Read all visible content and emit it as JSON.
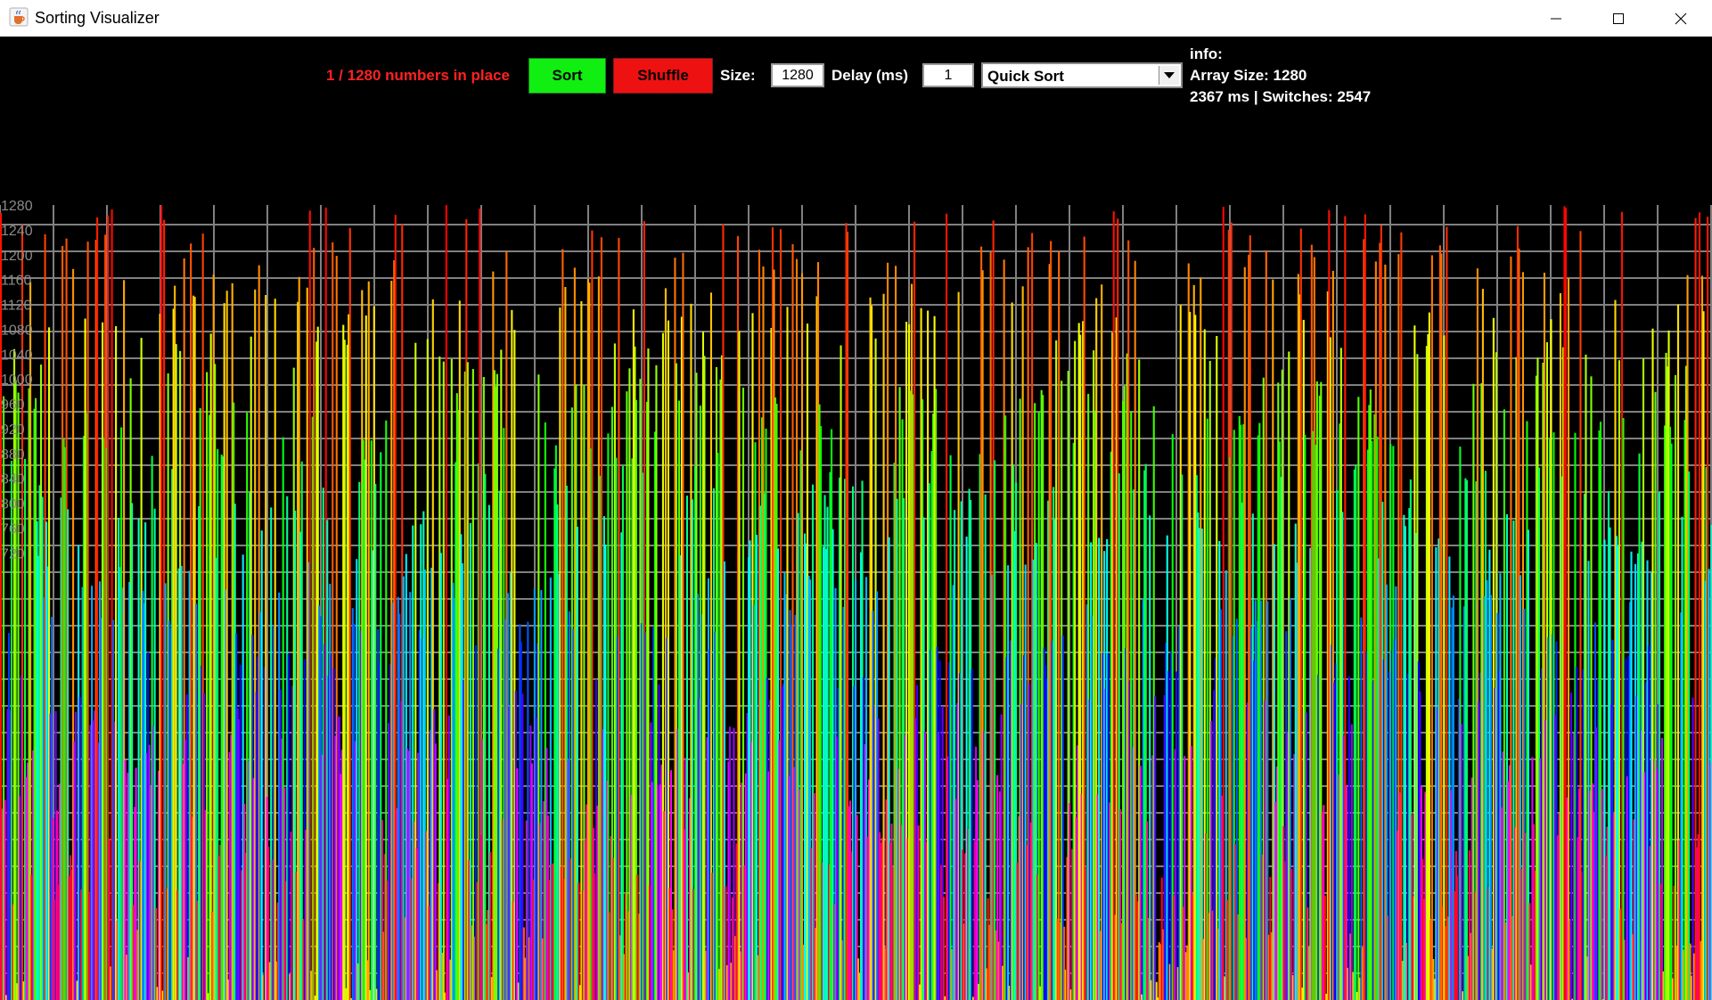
{
  "window": {
    "title": "Sorting Visualizer",
    "app_icon": "java-cup-icon"
  },
  "toolbar": {
    "status": "1 / 1280 numbers in place",
    "sort_label": "Sort",
    "shuffle_label": "Shuffle",
    "size_label": "Size:",
    "size_value": "1280",
    "delay_label": "Delay (ms)",
    "delay_value": "1",
    "algorithm": "Quick Sort"
  },
  "info": {
    "title": "info:",
    "array_size": "Array Size: 1280",
    "stats": "2367 ms | Switches: 2547"
  },
  "colors": {
    "status": "#ff2222",
    "sort": "#11ee11",
    "shuffle": "#ee1111",
    "grid": "#808080"
  },
  "chart_data": {
    "type": "bar",
    "y_tick_labels": [
      "1280",
      "1240",
      "1200",
      "1160",
      "1120",
      "1080",
      "1040",
      "1000",
      "960",
      "920",
      "880",
      "840",
      "800",
      "760",
      "720"
    ],
    "ylim": [
      0,
      1280
    ],
    "n": 1280,
    "seed": 7,
    "grid": true
  }
}
